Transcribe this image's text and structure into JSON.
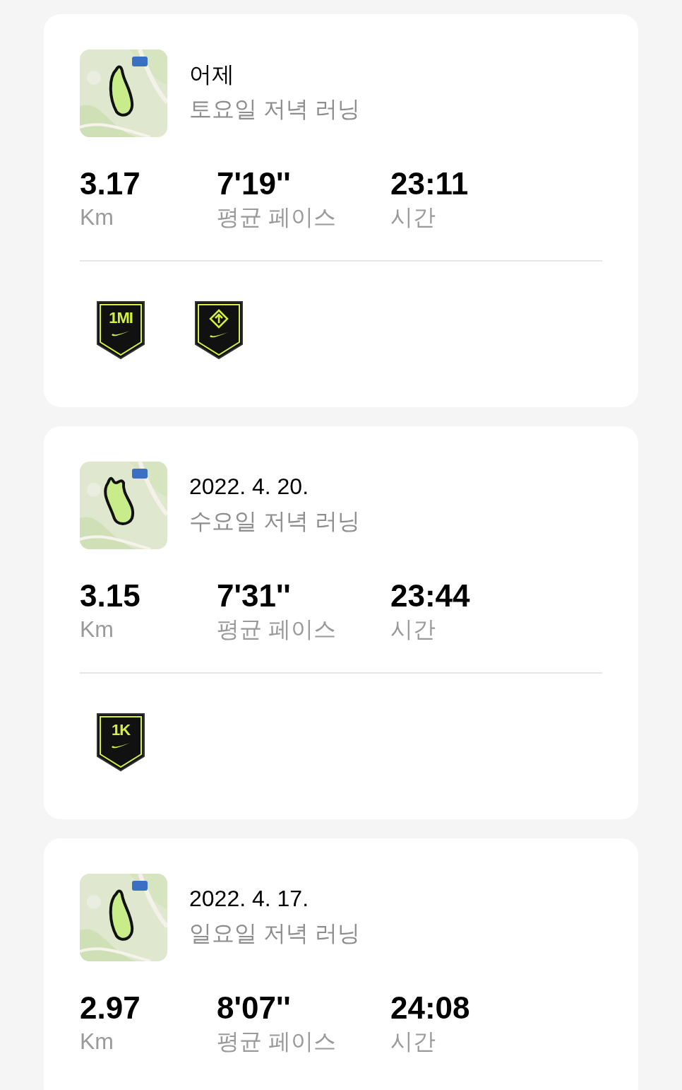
{
  "runs": [
    {
      "date": "어제",
      "title": "토요일 저녁 러닝",
      "distance": "3.17",
      "distance_label": "Km",
      "pace": "7'19''",
      "pace_label": "평균 페이스",
      "time": "23:11",
      "time_label": "시간",
      "badges": [
        {
          "kind": "text",
          "label": "1MI"
        },
        {
          "kind": "arrow"
        }
      ]
    },
    {
      "date": "2022. 4. 20.",
      "title": "수요일 저녁 러닝",
      "distance": "3.15",
      "distance_label": "Km",
      "pace": "7'31''",
      "pace_label": "평균 페이스",
      "time": "23:44",
      "time_label": "시간",
      "badges": [
        {
          "kind": "text",
          "label": "1K"
        }
      ]
    },
    {
      "date": "2022. 4. 17.",
      "title": "일요일 저녁 러닝",
      "distance": "2.97",
      "distance_label": "Km",
      "pace": "8'07''",
      "pace_label": "평균 페이스",
      "time": "24:08",
      "time_label": "시간"
    }
  ]
}
